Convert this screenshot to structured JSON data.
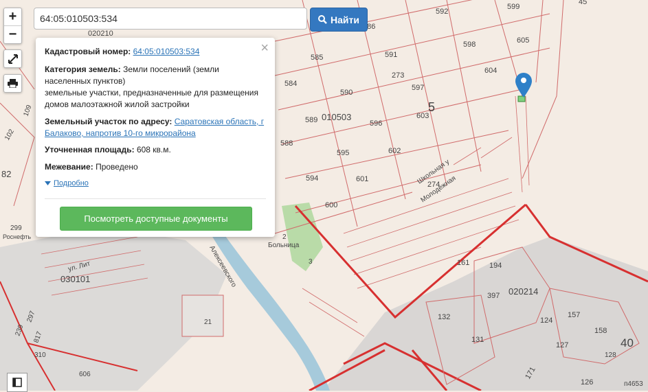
{
  "search": {
    "value": "64:05:010503:534",
    "button_label": "Найти",
    "icon": "search-icon"
  },
  "controls": {
    "zoom_in": "+",
    "zoom_out": "−",
    "fullscreen_icon": "expand-icon",
    "print_icon": "printer-icon",
    "layers_icon": "layers-icon"
  },
  "popup": {
    "cad_label": "Кадастровый номер:",
    "cad_value": "64:05:010503:534",
    "cat_label": "Категория земель:",
    "cat_value": "Земли поселений (земли населенных пунктов)",
    "usage": "земельные участки, предназначенные для размещения домов малоэтажной жилой застройки",
    "addr_label": "Земельный участок по адресу:",
    "addr_value": "Саратовская область, г Балаково, напротив 10-го микрорайона",
    "area_label": "Уточненная площадь:",
    "area_value": "608 кв.м.",
    "survey_label": "Межевание:",
    "survey_value": "Проведено",
    "more_label": "Подробно",
    "docs_button": "Посмотреть доступные документы"
  },
  "map": {
    "colors": {
      "background": "#f4ece4",
      "parcel_line": "#d06a6a",
      "block_line": "#d73030",
      "river": "#a6cadb",
      "gray": "#d2d2d2",
      "green": "#b9dba8",
      "marker": "#2e80c8"
    },
    "labels": [
      {
        "text": "592"
      },
      {
        "text": "599"
      },
      {
        "text": "45"
      },
      {
        "text": "586"
      },
      {
        "text": "598"
      },
      {
        "text": "605"
      },
      {
        "text": "585"
      },
      {
        "text": "591"
      },
      {
        "text": "604"
      },
      {
        "text": "273"
      },
      {
        "text": "584"
      },
      {
        "text": "590"
      },
      {
        "text": "597"
      },
      {
        "text": "603"
      },
      {
        "text": "5"
      },
      {
        "text": "589"
      },
      {
        "text": "010503"
      },
      {
        "text": "596"
      },
      {
        "text": "588"
      },
      {
        "text": "595"
      },
      {
        "text": "602"
      },
      {
        "text": "594"
      },
      {
        "text": "601"
      },
      {
        "text": "600"
      },
      {
        "text": "274"
      },
      {
        "text": "Школьная у"
      },
      {
        "text": "Молодежная"
      },
      {
        "text": "020210"
      },
      {
        "text": "2"
      },
      {
        "text": "Больница"
      },
      {
        "text": "3"
      },
      {
        "text": "161"
      },
      {
        "text": "194"
      },
      {
        "text": "397"
      },
      {
        "text": "020214"
      },
      {
        "text": "132"
      },
      {
        "text": "124"
      },
      {
        "text": "157"
      },
      {
        "text": "158"
      },
      {
        "text": "127"
      },
      {
        "text": "131"
      },
      {
        "text": "171"
      },
      {
        "text": "126"
      },
      {
        "text": "40"
      },
      {
        "text": "128"
      },
      {
        "text": "030101"
      },
      {
        "text": "297"
      },
      {
        "text": "239"
      },
      {
        "text": "817"
      },
      {
        "text": "310"
      },
      {
        "text": "21"
      },
      {
        "text": "82"
      },
      {
        "text": "102"
      },
      {
        "text": "109"
      },
      {
        "text": "299"
      },
      {
        "text": "Роснефть"
      },
      {
        "text": "Алексеевского"
      },
      {
        "text": "ул. Лит"
      },
      {
        "text": "606"
      },
      {
        "text": "п4653"
      }
    ]
  }
}
